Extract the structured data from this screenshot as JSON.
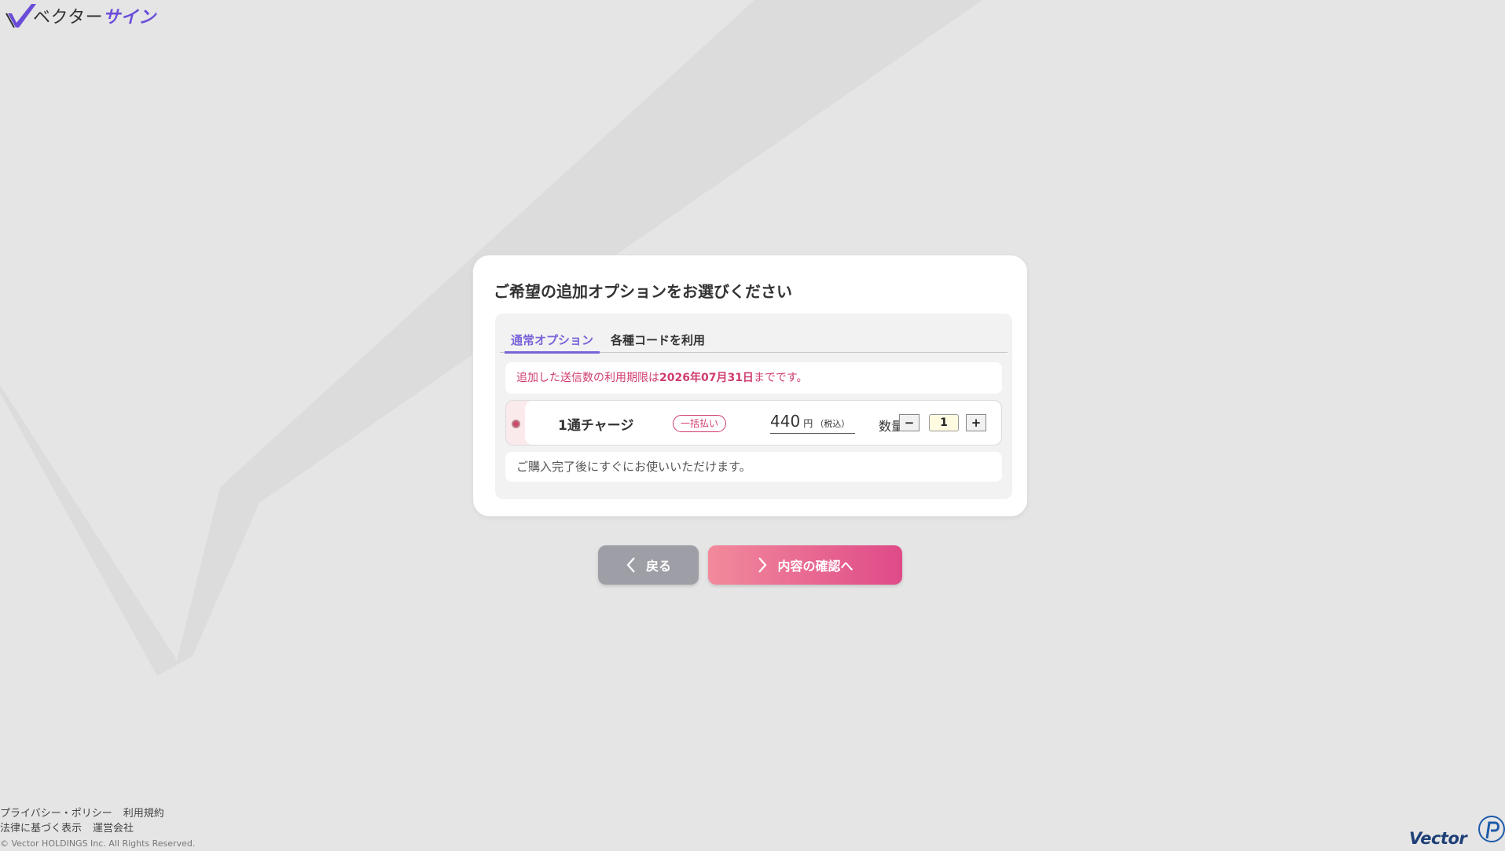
{
  "brand": {
    "logo_text_main": "ベクター",
    "logo_text_accent": "サイン",
    "accent_color": "#6a4cd8",
    "pink_color": "#d03c6e"
  },
  "card": {
    "title": "ご希望の追加オプションをお選びください",
    "tabs": [
      {
        "label": "通常オプション",
        "active": true
      },
      {
        "label": "各種コードを利用",
        "active": false
      }
    ],
    "notice_prefix": "追加した送信数の利用期限は",
    "notice_date": "2026年07月31日",
    "notice_suffix": "までです。",
    "option": {
      "selected": true,
      "name": "1通チャージ",
      "badge": "一括払い",
      "price": "440",
      "unit": "円",
      "tax": "（税込）",
      "qty_label": "数量",
      "qty_minus": "−",
      "qty_plus": "+",
      "qty_value": "1"
    },
    "description": "ご購入完了後にすぐにお使いいただけます。"
  },
  "actions": {
    "back_label": "戻る",
    "next_label": "内容の確認へ"
  },
  "footer": {
    "links_row1": [
      "プライバシー・ポリシー",
      "利用規約"
    ],
    "links_row2": [
      "法律に基づく表示",
      "運営会社"
    ],
    "copyright": "© Vector HOLDINGS Inc. All Rights Reserved."
  },
  "corner": {
    "vector_logo": "Vector"
  }
}
